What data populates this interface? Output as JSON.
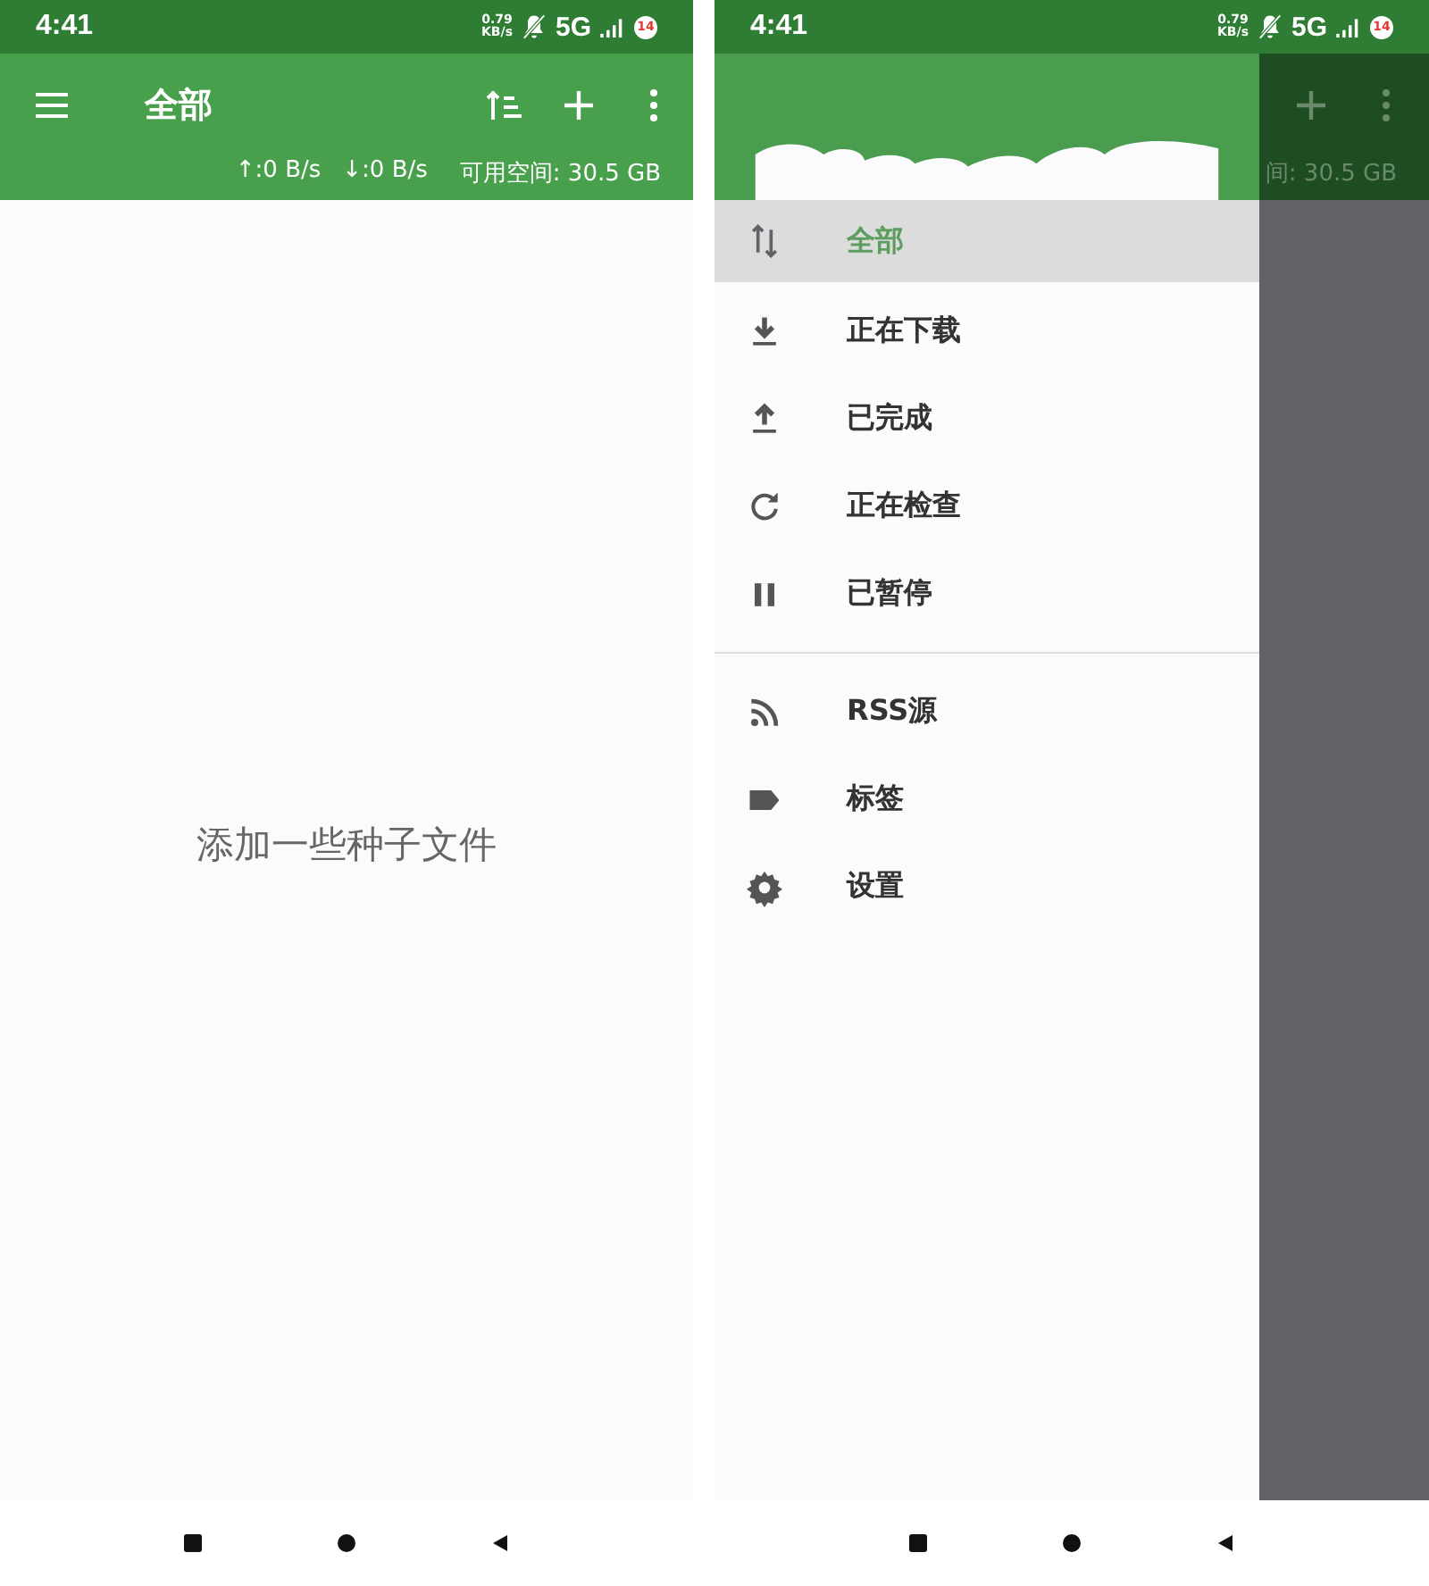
{
  "left_screen": {
    "status_bar": {
      "time": "4:41",
      "net_speed": "0.79",
      "net_unit": "KB/s",
      "network": "5G",
      "battery": "14"
    },
    "app_bar": {
      "title": "全部"
    },
    "speed_bar": {
      "upload": "↑:0 B/s",
      "download": "↓:0 B/s",
      "free_space": "可用空间: 30.5 GB"
    },
    "empty_message": "添加一些种子文件"
  },
  "right_screen": {
    "status_bar": {
      "time": "4:41",
      "net_speed": "0.79",
      "net_unit": "KB/s",
      "network": "5G",
      "battery": "14"
    },
    "drawer": {
      "sections": [
        {
          "items": [
            {
              "label": "全部",
              "selected": true
            },
            {
              "label": "正在下载",
              "selected": false
            },
            {
              "label": "已完成",
              "selected": false
            },
            {
              "label": "正在检查",
              "selected": false
            },
            {
              "label": "已暂停",
              "selected": false
            }
          ]
        },
        {
          "items": [
            {
              "label": "RSS源",
              "selected": false
            },
            {
              "label": "标签",
              "selected": false
            },
            {
              "label": "设置",
              "selected": false
            }
          ]
        }
      ]
    },
    "dimmed_free_space": "间: 30.5 GB"
  }
}
